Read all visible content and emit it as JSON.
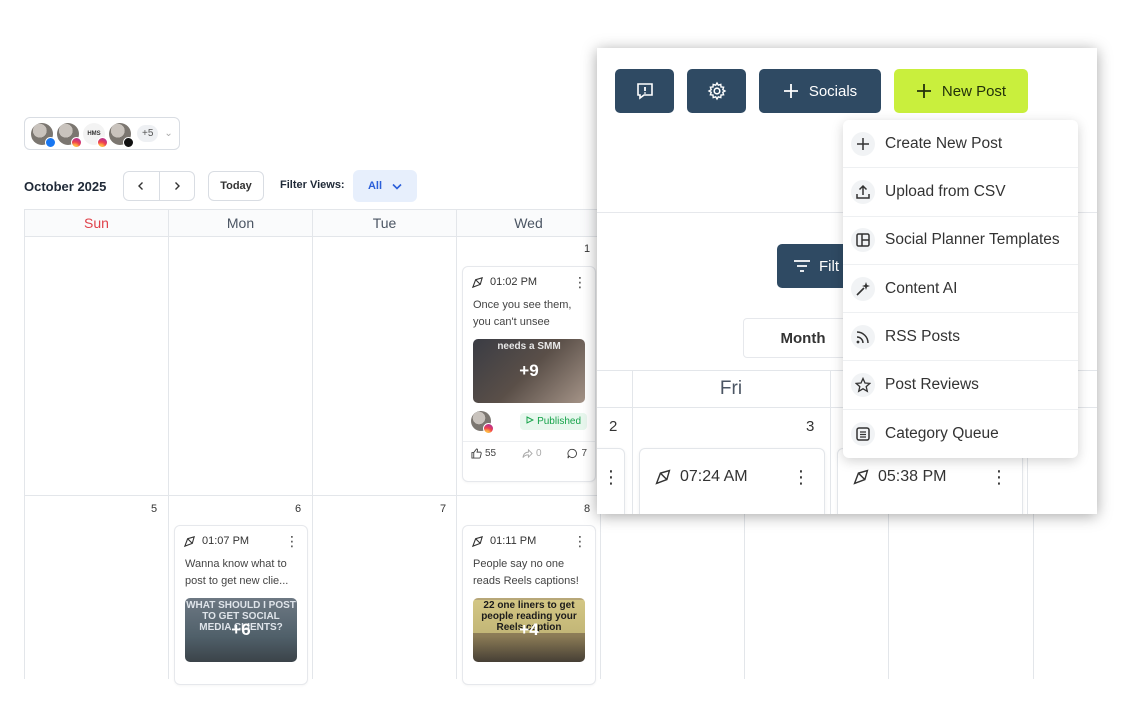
{
  "toolbar": {
    "accounts_more": "+5",
    "month_label": "October 2025",
    "prev_icon": "chevron-left-icon",
    "next_icon": "chevron-right-icon",
    "today_label": "Today",
    "filter_views_label": "Filter Views:",
    "filter_value": "All"
  },
  "calendar": {
    "weekdays": [
      "Sun",
      "Mon",
      "Tue",
      "Wed"
    ],
    "week1": {
      "wed_num": "1"
    },
    "week2": {
      "sun_num": "5",
      "mon_num": "6",
      "tue_num": "7",
      "wed_num": "8"
    },
    "posts": [
      {
        "time": "01:02 PM",
        "text": "Once you see them, you can't unsee them...",
        "image_caption": "needs a SMM",
        "media_count": "+9",
        "status": "Published",
        "likes": "55",
        "shares": "0",
        "comments": "7"
      },
      {
        "time": "01:07 PM",
        "text": "Wanna know what to post to get new clie...",
        "image_caption": "WHAT SHOULD I POST TO GET SOCIAL MEDIA CLIENTS?",
        "media_count": "+6"
      },
      {
        "time": "01:11 PM",
        "text": "People say no one reads Reels captions! ...",
        "image_caption": "22 one liners to get people reading your Reels caption",
        "media_count": "+4"
      }
    ]
  },
  "popup": {
    "feedback_icon": "feedback-icon",
    "settings_icon": "gear-icon",
    "socials_label": "Socials",
    "new_post_label": "New Post",
    "filter_label": "Filt",
    "month_tab": "Month",
    "fri_label": "Fri",
    "day_2": "2",
    "day_3": "3",
    "card1_time": "07:24 AM",
    "card2_time": "05:38 PM",
    "menu": [
      {
        "label": "Create New Post",
        "icon": "plus-icon"
      },
      {
        "label": "Upload from CSV",
        "icon": "upload-icon"
      },
      {
        "label": "Social Planner Templates",
        "icon": "template-icon"
      },
      {
        "label": "Content AI",
        "icon": "sparkle-icon"
      },
      {
        "label": "RSS Posts",
        "icon": "rss-icon"
      },
      {
        "label": "Post Reviews",
        "icon": "star-icon"
      },
      {
        "label": "Category Queue",
        "icon": "list-icon"
      }
    ]
  },
  "colors": {
    "navy_button": "#2f4a63",
    "new_post_lime": "#c9ef3d",
    "sunday_red": "#e0424b",
    "published_green": "#16a34a",
    "filter_blue": "#2b5fd9"
  }
}
